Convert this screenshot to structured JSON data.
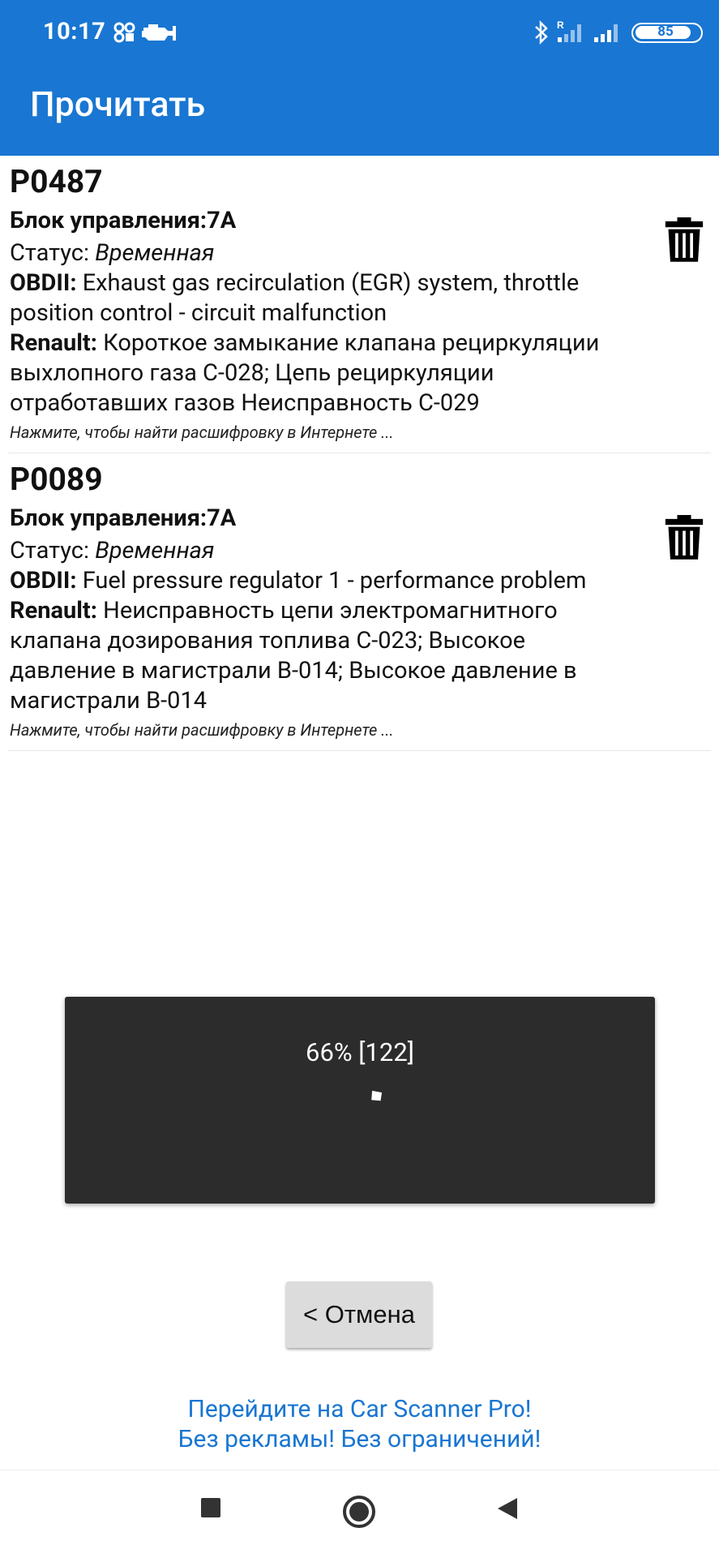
{
  "status_bar": {
    "time": "10:17",
    "battery": "85",
    "icons": [
      "notification-icon",
      "engine-icon",
      "bluetooth-icon",
      "signal-icon",
      "signal-icon",
      "battery-icon"
    ]
  },
  "app_bar": {
    "title": "Прочитать"
  },
  "dtcs": [
    {
      "code": "P0487",
      "ecu_label": "Блок управления:",
      "ecu_value": "7A",
      "status_label": "Статус:",
      "status_value": "Временная",
      "obd_label": "OBDII:",
      "obd_desc_1": "Exhaust gas recirculation (EGR) system, throttle",
      "obd_desc_2": "position control - circuit malfunction",
      "maker_label": "Renault:",
      "maker_desc_1": "Короткое замыкание клапана рециркуляции",
      "maker_desc_2": "выхлопного газа C-028; Цепь рециркуляции",
      "maker_desc_3": "отработавших газов Неисправность C-029",
      "hint": "Нажмите, чтобы найти расшифровку в Интернете ..."
    },
    {
      "code": "P0089",
      "ecu_label": "Блок управления:",
      "ecu_value": "7A",
      "status_label": "Статус:",
      "status_value": "Временная",
      "obd_label": "OBDII:",
      "obd_desc_1": "Fuel pressure regulator 1 - performance problem",
      "maker_label": "Renault:",
      "maker_desc_1": "Неисправность цепи электромагнитного",
      "maker_desc_2": "клапана дозирования топлива C-023; Высокое",
      "maker_desc_3": "давление в магистрали B-014; Высокое давление в",
      "maker_desc_4": "магистрали B-014",
      "hint": "Нажмите, чтобы найти расшифровку в Интернете ..."
    }
  ],
  "progress_dialog": {
    "text": "66% [122]",
    "percent": 66
  },
  "cancel_button": {
    "label": "< Отмена"
  },
  "promo": {
    "line1": "Перейдите на Car Scanner Pro!",
    "line2": "Без рекламы! Без ограничений!"
  },
  "colors": {
    "primary": "#1976d2",
    "dialog_bg": "#2c2c2c",
    "button_bg": "#dcdcdc"
  },
  "nav_bar": {
    "buttons": [
      "square-recents-icon",
      "circle-home-icon",
      "triangle-back-icon"
    ]
  }
}
